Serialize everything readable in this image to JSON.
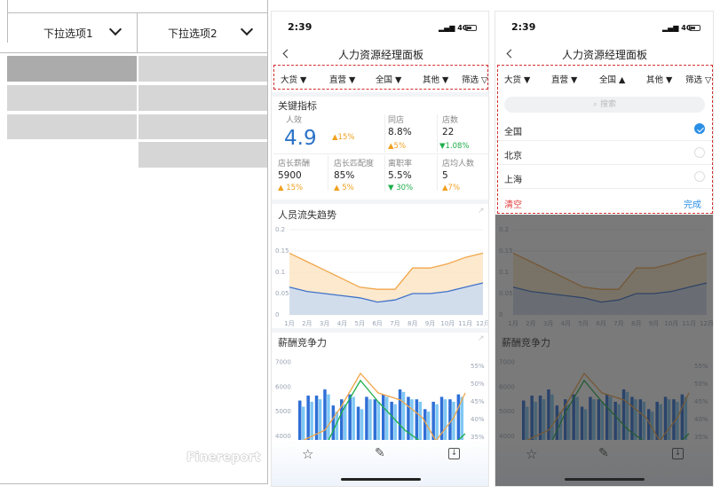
{
  "wireframe": {
    "dropdown1": "下拉选项1",
    "dropdown2": "下拉选项2"
  },
  "status": {
    "time": "2:39",
    "signal": "4G"
  },
  "nav": {
    "title": "人力资源经理面板"
  },
  "filters": [
    {
      "label": "大货"
    },
    {
      "label": "直营"
    },
    {
      "label": "全国"
    },
    {
      "label": "其他"
    },
    {
      "label": "筛选"
    }
  ],
  "kpi": {
    "title": "关键指标",
    "efficiency": {
      "label": "人效",
      "value": "4.9",
      "change": "▲15%"
    },
    "same_store": {
      "label": "同店",
      "value": "8.8%",
      "change": "▲5%"
    },
    "store_count": {
      "label": "店数",
      "value": "22",
      "change": "▼1.08%"
    },
    "salary": {
      "label": "店长薪酬",
      "value": "5900",
      "change": "▲ 15%"
    },
    "match": {
      "label": "店长匹配度",
      "value": "85%",
      "change": "▲ 5%"
    },
    "turnover": {
      "label": "离职率",
      "value": "5.5%",
      "change": "▼ 30%"
    },
    "avg_staff": {
      "label": "店均人数",
      "value": "5",
      "change": "▲7%"
    }
  },
  "chart1_title": "人员流失趋势",
  "chart2_title": "薪酬竞争力",
  "chart_data": [
    {
      "type": "area",
      "x": [
        "1月",
        "2月",
        "3月",
        "4月",
        "5月",
        "6月",
        "7月",
        "8月",
        "9月",
        "10月",
        "11月",
        "12月"
      ],
      "ylim": [
        0,
        0.2
      ],
      "yticks": [
        "0",
        "0.05",
        "0.1",
        "0.15",
        "0.2"
      ],
      "series": [
        {
          "values": [
            0.145,
            0.125,
            0.105,
            0.085,
            0.065,
            0.06,
            0.06,
            0.11,
            0.11,
            0.12,
            0.135,
            0.145
          ]
        },
        {
          "values": [
            0.065,
            0.055,
            0.05,
            0.045,
            0.04,
            0.03,
            0.035,
            0.05,
            0.05,
            0.055,
            0.065,
            0.075
          ]
        }
      ]
    },
    {
      "type": "bar",
      "yticks_left": [
        "4000",
        "5000",
        "6000",
        "7000"
      ],
      "yticks_right": [
        "35%",
        "40%",
        "45%",
        "50%",
        "55%"
      ],
      "ylim": [
        3600,
        7200
      ],
      "series": [
        {
          "values": [
            5450,
            5650,
            5650,
            5900,
            5250,
            5500,
            5700,
            5200,
            5600,
            5500,
            5700,
            5400,
            5900,
            5600,
            5500,
            5100,
            5400,
            5600,
            5500,
            5700
          ]
        },
        {
          "values": [
            5200,
            5400,
            5500,
            5700,
            5000,
            5300,
            5600,
            5100,
            5500,
            5400,
            5600,
            5300,
            5800,
            5500,
            5400,
            5000,
            5300,
            5500,
            5400,
            5600
          ]
        }
      ]
    }
  ],
  "panel": {
    "search_placeholder": "搜索",
    "options": [
      {
        "label": "全国",
        "checked": true
      },
      {
        "label": "北京",
        "checked": false
      },
      {
        "label": "上海",
        "checked": false
      }
    ],
    "clear": "清空",
    "done": "完成"
  },
  "watermark": "Finereport"
}
